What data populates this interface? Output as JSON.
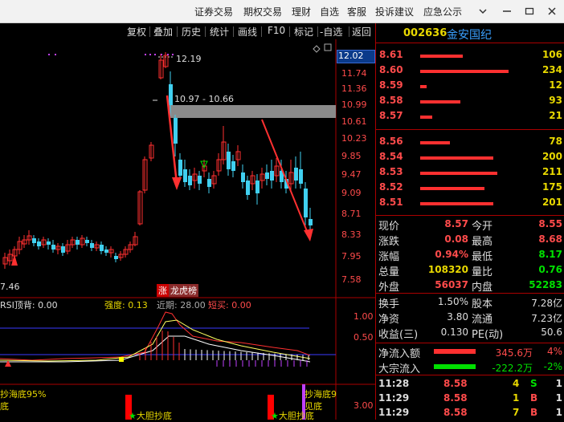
{
  "menu": {
    "items": [
      "证券交易",
      "期权交易",
      "理财",
      "自选",
      "客服",
      "投诉建议",
      "应急公示"
    ]
  },
  "toolbar": {
    "items": [
      "复权",
      "叠加",
      "历史",
      "统计",
      "画线",
      "F10",
      "标记",
      "-自选",
      "返回"
    ]
  },
  "chart": {
    "price_labels": [
      "12.02",
      "11.74",
      "11.36",
      "10.99",
      "10.61",
      "10.23",
      "9.85",
      "9.47",
      "9.09",
      "8.71",
      "8.33",
      "7.95",
      "7.58"
    ],
    "high_label": "12.19",
    "low_label": "7.46",
    "box_label": "10.97 - 10.66",
    "badges": [
      "涨",
      "龙虎榜"
    ]
  },
  "indicator": {
    "name": "RSI顶背: 0.00",
    "strength": "强度: 0.13",
    "recent": "近期: 28.00",
    "short_buy": "短买: 0.00",
    "levels": [
      "1.00",
      "0.50"
    ]
  },
  "lower": {
    "left_text": "抄海底95%",
    "left_sub": "底",
    "mid_text": "大胆抄底",
    "right_text": "大胆抄底",
    "right_top": "抄海底9",
    "right_sub": "见底",
    "level": "3.00"
  },
  "stock": {
    "code": "002636",
    "name": "金安国纪"
  },
  "order_book": {
    "asks": [
      {
        "price": "8.61",
        "vol": "106",
        "bar": 0.48
      },
      {
        "price": "8.60",
        "vol": "234",
        "bar": 1.0
      },
      {
        "price": "8.59",
        "vol": "12",
        "bar": 0.07
      },
      {
        "price": "8.58",
        "vol": "93",
        "bar": 0.45
      },
      {
        "price": "8.57",
        "vol": "21",
        "bar": 0.14
      }
    ],
    "bids": [
      {
        "price": "8.56",
        "vol": "78",
        "bar": 0.38
      },
      {
        "price": "8.54",
        "vol": "200",
        "bar": 0.93
      },
      {
        "price": "8.53",
        "vol": "211",
        "bar": 0.98
      },
      {
        "price": "8.52",
        "vol": "175",
        "bar": 0.82
      },
      {
        "price": "8.51",
        "vol": "201",
        "bar": 0.93
      }
    ]
  },
  "quote": [
    {
      "l1": "现价",
      "v1": "8.57",
      "c1": "red",
      "l2": "今开",
      "v2": "8.55",
      "c2": "red"
    },
    {
      "l1": "涨跌",
      "v1": "0.08",
      "c1": "red",
      "l2": "最高",
      "v2": "8.68",
      "c2": "red"
    },
    {
      "l1": "涨幅",
      "v1": "0.94%",
      "c1": "red",
      "l2": "最低",
      "v2": "8.17",
      "c2": "green"
    },
    {
      "l1": "总量",
      "v1": "108320",
      "c1": "yellow",
      "l2": "量比",
      "v2": "0.76",
      "c2": "green"
    },
    {
      "l1": "外盘",
      "v1": "56037",
      "c1": "red",
      "l2": "内盘",
      "v2": "52283",
      "c2": "green"
    }
  ],
  "stats": [
    {
      "l1": "换手",
      "v1": "1.50%",
      "l2": "股本",
      "v2": "7.28亿"
    },
    {
      "l1": "净资",
      "v1": "3.80",
      "l2": "流通",
      "v2": "7.23亿"
    },
    {
      "l1": "收益(三)",
      "v1": "0.130",
      "l2": "PE(动)",
      "v2": "50.6"
    }
  ],
  "flows": [
    {
      "label": "净流入额",
      "value": "345.6万",
      "pct": "4%",
      "color": "#ff3030",
      "vclass": "red"
    },
    {
      "label": "大宗流入",
      "value": "-222.2万",
      "pct": "-2%",
      "color": "#00e000",
      "vclass": "green"
    }
  ],
  "ticks": [
    {
      "time": "11:28",
      "price": "8.58",
      "vol": "4",
      "side": "S",
      "n": "1"
    },
    {
      "time": "11:29",
      "price": "8.58",
      "vol": "1",
      "side": "B",
      "n": "1"
    },
    {
      "time": "11:29",
      "price": "8.58",
      "vol": "7",
      "side": "B",
      "n": "1"
    }
  ]
}
